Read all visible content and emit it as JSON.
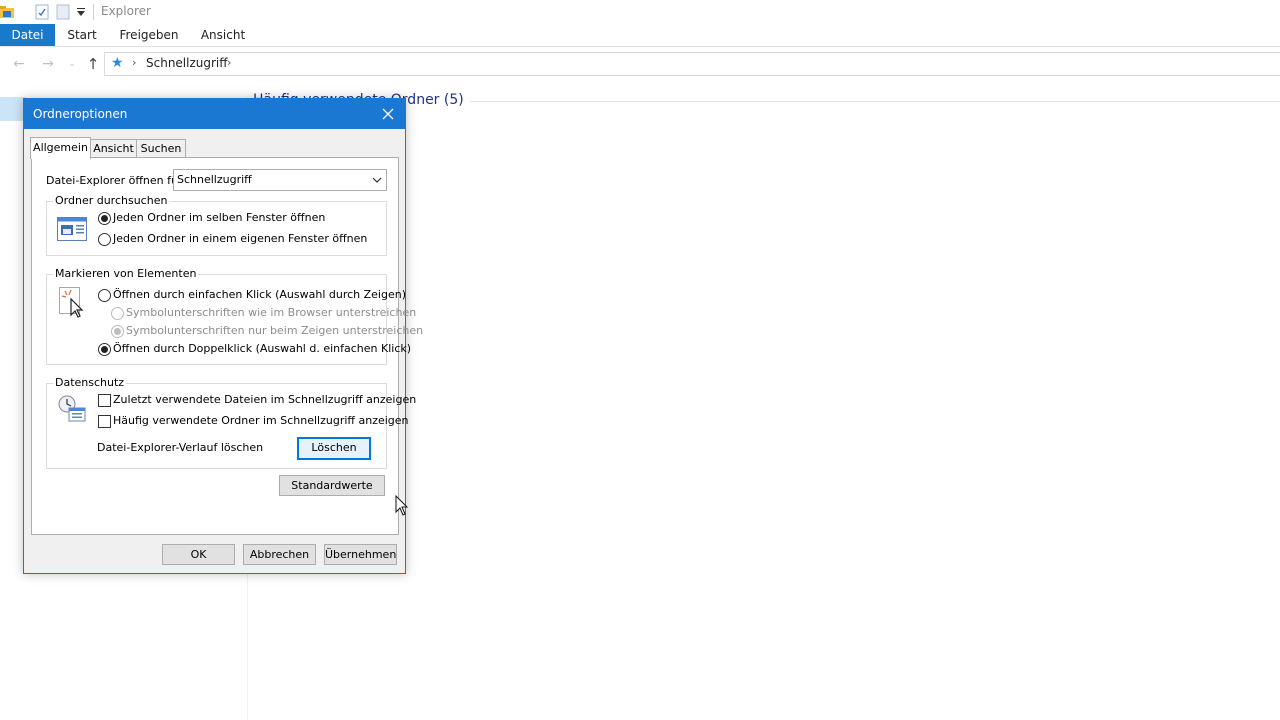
{
  "explorer": {
    "window_title": "Explorer",
    "ribbon_tabs": [
      "Datei",
      "Start",
      "Freigeben",
      "Ansicht"
    ],
    "address": {
      "location": "Schnellzugriff"
    },
    "group_header": "Häufig verwendete Ordner (5)"
  },
  "dialog": {
    "title": "Ordneroptionen",
    "tabs": [
      "Allgemein",
      "Ansicht",
      "Suchen"
    ],
    "open_label": "Datei-Explorer öffnen für:",
    "open_value": "Schnellzugriff",
    "browse": {
      "title": "Ordner durchsuchen",
      "options": [
        {
          "label": "Jeden Ordner im selben Fenster öffnen",
          "checked": true
        },
        {
          "label": "Jeden Ordner in einem eigenen Fenster öffnen",
          "checked": false
        }
      ]
    },
    "click": {
      "title": "Markieren von Elementen",
      "single_click": "Öffnen durch einfachen Klick (Auswahl durch Zeigen)",
      "underline_browser": "Symbolunterschriften wie im Browser unterstreichen",
      "underline_hover": "Symbolunterschriften nur beim Zeigen unterstreichen",
      "double_click": "Öffnen durch Doppelklick (Auswahl d. einfachen Klick)"
    },
    "privacy": {
      "title": "Datenschutz",
      "recent_files": "Zuletzt verwendete Dateien im Schnellzugriff anzeigen",
      "frequent_folders": "Häufig verwendete Ordner im Schnellzugriff anzeigen",
      "clear_label": "Datei-Explorer-Verlauf löschen",
      "clear_button": "Löschen"
    },
    "defaults_button": "Standardwerte",
    "ok_button": "OK",
    "cancel_button": "Abbrechen",
    "apply_button": "Übernehmen"
  }
}
